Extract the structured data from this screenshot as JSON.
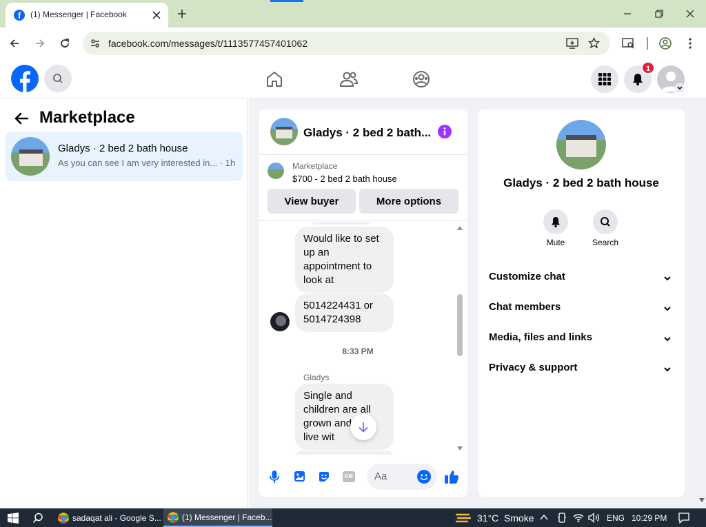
{
  "browser": {
    "tab_title": "(1) Messenger | Facebook",
    "url": "facebook.com/messages/t/1113577457401062"
  },
  "fb": {
    "notification_count": "1"
  },
  "left": {
    "title": "Marketplace",
    "thread": {
      "name": "Gladys · 2 bed 2 bath house",
      "preview": "As you can see I am very interested in...",
      "time": "· 1h"
    }
  },
  "chat": {
    "header_title": "Gladys · 2 bed 2 bath...",
    "listing_source": "Marketplace",
    "listing_title": "$700 - 2 bed 2 bath house",
    "view_buyer": "View buyer",
    "more_options": "More options",
    "messages": [
      {
        "text": "Would like to set up an appointment to look at"
      },
      {
        "text": "5014224431 or 5014724398"
      }
    ],
    "timestamp": "8:33 PM",
    "sender": "Gladys",
    "last_message": "Single and children are all grown and not live wit",
    "composer_placeholder": "Aa"
  },
  "info": {
    "title": "Gladys · 2 bed 2 bath house",
    "mute": "Mute",
    "search": "Search",
    "sections": [
      "Customize chat",
      "Chat members",
      "Media, files and links",
      "Privacy & support"
    ]
  },
  "taskbar": {
    "app1": "sadaqat ali - Google S...",
    "app2": "(1) Messenger | Faceb...",
    "weather_temp": "31°C",
    "weather_desc": "Smoke",
    "lang": "ENG",
    "time": "10:29 PM"
  },
  "colors": {
    "fb_blue": "#0866ff",
    "accent_purple": "#a033ff",
    "chrome_green": "#d3e3c6"
  }
}
